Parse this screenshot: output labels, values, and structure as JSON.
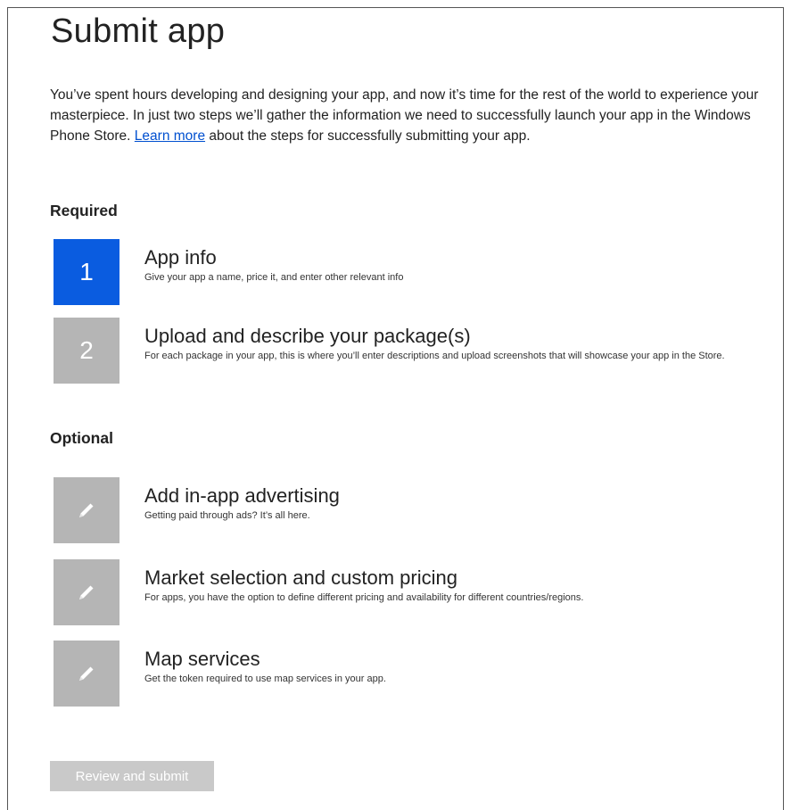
{
  "page": {
    "title": "Submit app",
    "intro_before_link": "You’ve spent hours developing and designing your app, and now it’s time for the rest of the world to experience your masterpiece. In just two steps we’ll gather the information we need to successfully launch your app in the Windows Phone Store. ",
    "intro_link": "Learn more",
    "intro_after_link": " about the steps for successfully submitting your app."
  },
  "required": {
    "heading": "Required",
    "steps": [
      {
        "number": "1",
        "title": "App info",
        "description": "Give your app a name, price it, and enter other relevant info",
        "active": true
      },
      {
        "number": "2",
        "title": "Upload and describe your package(s)",
        "description": "For each package in your app, this is where you’ll enter descriptions and upload screenshots that will showcase your app in the Store.",
        "active": false
      }
    ]
  },
  "optional": {
    "heading": "Optional",
    "items": [
      {
        "icon": "pencil-icon",
        "title": "Add in-app advertising",
        "description": "Getting paid through ads? It’s all here."
      },
      {
        "icon": "pencil-icon",
        "title": "Market selection and custom pricing",
        "description": "For apps, you have the option to define different pricing and availability for different countries/regions."
      },
      {
        "icon": "pencil-icon",
        "title": "Map services",
        "description": "Get the token required to use map services in your app."
      }
    ]
  },
  "footer": {
    "submit_label": "Review and submit"
  },
  "colors": {
    "active_tile": "#0a5ce0",
    "inactive_tile": "#b5b5b5",
    "link": "#0050d0",
    "disabled_button": "#c9c9c9"
  }
}
